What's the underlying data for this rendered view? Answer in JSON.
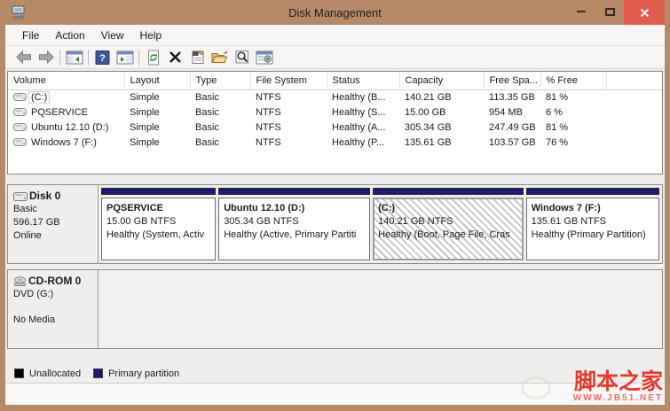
{
  "window": {
    "title": "Disk Management",
    "controls": [
      "minimize",
      "maximize",
      "close"
    ]
  },
  "menu": {
    "items": [
      "File",
      "Action",
      "View",
      "Help"
    ]
  },
  "toolbar": {
    "icons": [
      "back-arrow",
      "forward-arrow",
      "show-console-tree",
      "help",
      "show-action-pane",
      "refresh",
      "delete-volume",
      "properties",
      "open",
      "view",
      "settings-window"
    ]
  },
  "volume_table": {
    "columns": [
      "Volume",
      "Layout",
      "Type",
      "File System",
      "Status",
      "Capacity",
      "Free Spa...",
      "% Free"
    ],
    "rows": [
      {
        "volume": "(C:)",
        "layout": "Simple",
        "type": "Basic",
        "file_system": "NTFS",
        "status": "Healthy (B...",
        "capacity": "140.21 GB",
        "free_space": "113.35 GB",
        "pct_free": "81 %"
      },
      {
        "volume": "PQSERVICE",
        "layout": "Simple",
        "type": "Basic",
        "file_system": "NTFS",
        "status": "Healthy (S...",
        "capacity": "15.00 GB",
        "free_space": "954 MB",
        "pct_free": "6 %"
      },
      {
        "volume": "Ubuntu 12.10 (D:)",
        "layout": "Simple",
        "type": "Basic",
        "file_system": "NTFS",
        "status": "Healthy (A...",
        "capacity": "305.34 GB",
        "free_space": "247.49 GB",
        "pct_free": "81 %"
      },
      {
        "volume": "Windows 7 (F:)",
        "layout": "Simple",
        "type": "Basic",
        "file_system": "NTFS",
        "status": "Healthy (P...",
        "capacity": "135.61 GB",
        "free_space": "103.57 GB",
        "pct_free": "76 %"
      }
    ]
  },
  "graphical": {
    "disks": [
      {
        "name": "Disk 0",
        "type": "Basic",
        "size": "596.17 GB",
        "status": "Online",
        "partitions": [
          {
            "name": "PQSERVICE",
            "size_line": "15.00 GB NTFS",
            "status_line": "Healthy (System, Activ"
          },
          {
            "name": "Ubuntu 12.10 (D:)",
            "size_line": "305.34 GB NTFS",
            "status_line": "Healthy (Active, Primary Partiti"
          },
          {
            "name": "(C:)",
            "size_line": "140.21 GB NTFS",
            "status_line": "Healthy (Boot, Page File, Cras"
          },
          {
            "name": "Windows 7 (F:)",
            "size_line": "135.61 GB NTFS",
            "status_line": "Healthy (Primary Partition)"
          }
        ]
      },
      {
        "name": "CD-ROM 0",
        "type": "DVD (G:)",
        "status": "No Media",
        "partitions": []
      }
    ]
  },
  "legend": {
    "items": [
      {
        "label": "Unallocated",
        "color": "#000000"
      },
      {
        "label": "Primary partition",
        "color": "#1b1b70"
      }
    ]
  },
  "watermark": {
    "title": "脚本之家",
    "site": "WWW.JB51.NET"
  },
  "colors": {
    "titlebar": "#b68a68",
    "close_button": "#e25d51",
    "primary_partition": "#1b1b70",
    "unallocated": "#000000",
    "watermark": "#e6392e"
  }
}
